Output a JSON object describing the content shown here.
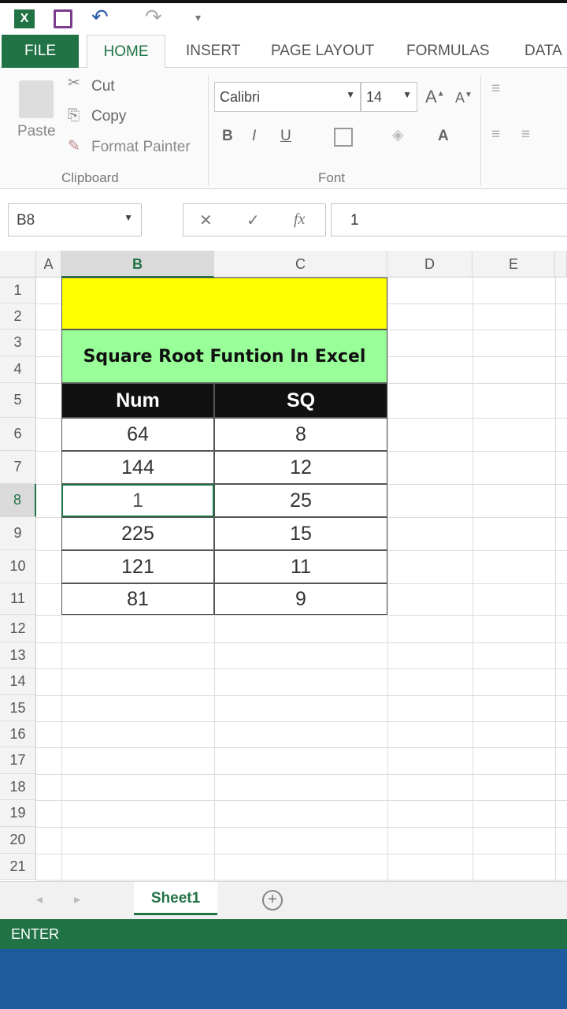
{
  "quick_access": {
    "app_icon": "excel-icon",
    "save_icon": "save-icon",
    "undo_icon": "undo-icon",
    "redo_icon": "redo-icon",
    "customize_icon": "customize-icon"
  },
  "tabs": [
    "FILE",
    "HOME",
    "INSERT",
    "PAGE LAYOUT",
    "FORMULAS",
    "DATA"
  ],
  "active_tab": "HOME",
  "ribbon": {
    "clipboard": {
      "paste": "Paste",
      "cut": "Cut",
      "copy": "Copy",
      "format_painter": "Format Painter",
      "group_label": "Clipboard"
    },
    "font": {
      "font_name": "Calibri",
      "font_size": "14",
      "bold": "B",
      "italic": "I",
      "underline": "U",
      "font_color": "A",
      "group_label": "Font"
    }
  },
  "formula_bar": {
    "name_box": "B8",
    "cancel": "✕",
    "enter": "✓",
    "fx": "fx",
    "value": "1"
  },
  "columns": [
    "A",
    "B",
    "C",
    "D",
    "E"
  ],
  "rows": [
    "1",
    "2",
    "3",
    "4",
    "5",
    "6",
    "7",
    "8",
    "9",
    "10",
    "11",
    "12",
    "13",
    "14",
    "15",
    "16",
    "17",
    "18",
    "19",
    "20",
    "21"
  ],
  "active_cell": "B8",
  "sheet": {
    "title": "Square Root Funtion In Excel",
    "headers": [
      "Num",
      "SQ"
    ],
    "data": [
      [
        "64",
        "8"
      ],
      [
        "144",
        "12"
      ],
      [
        "1",
        "25"
      ],
      [
        "225",
        "15"
      ],
      [
        "121",
        "11"
      ],
      [
        "81",
        "9"
      ]
    ]
  },
  "colors": {
    "title_top": "#ffff00",
    "title_fill": "#99ff99",
    "header_fill": "#111111",
    "accent": "#217346",
    "taskbar": "#1e5b9e"
  },
  "sheet_tabs": {
    "active": "Sheet1",
    "add_icon": "plus-icon"
  },
  "status": "ENTER"
}
